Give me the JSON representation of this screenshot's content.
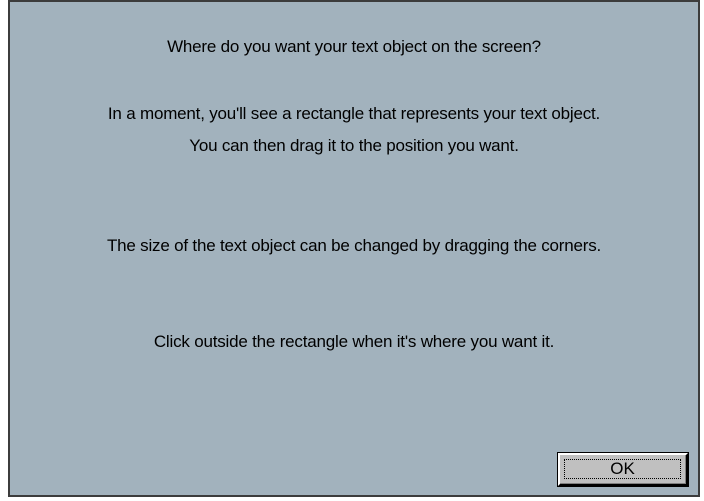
{
  "dialog": {
    "lines": [
      "Where do you want your text object on the screen?",
      "In a moment, you'll see a rectangle that represents your text object.",
      "You can then drag it to the position you want.",
      "The size of the text object can be changed by dragging the corners.",
      "Click outside the rectangle when it's where you want it."
    ],
    "ok_label": "OK",
    "colors": {
      "background": "#a2b2bd",
      "border": "#3c3c3c",
      "button_face": "#c0c0c0"
    }
  }
}
